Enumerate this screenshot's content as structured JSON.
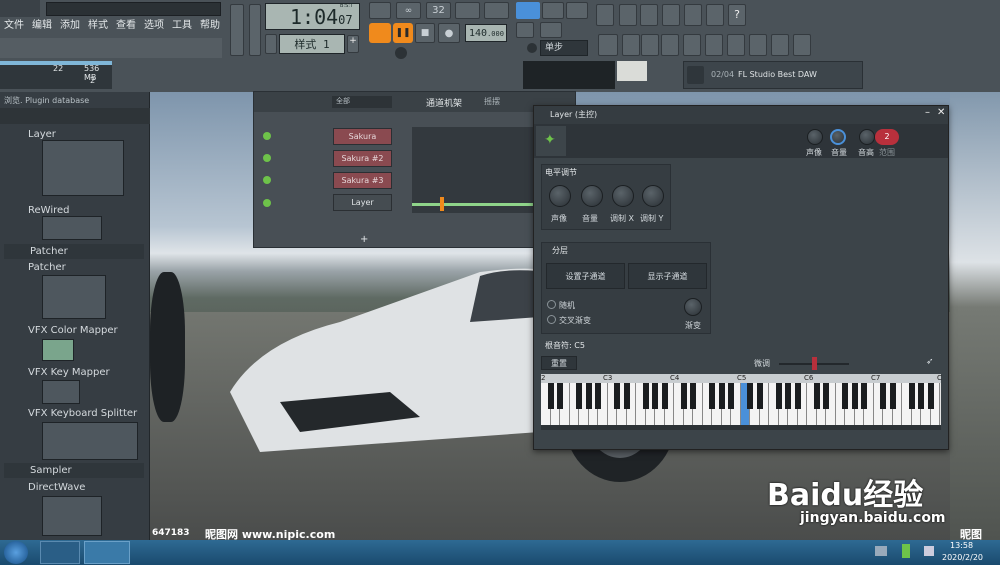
{
  "menu": [
    "文件",
    "编辑",
    "添加",
    "样式",
    "查看",
    "选项",
    "工具",
    "帮助"
  ],
  "toolbar": {
    "time": "1:04",
    "time_small": "07",
    "time_unit": "B:S:T",
    "pattern": "样式 1",
    "tempo": "140",
    "tempo_dec": ".000",
    "snap": "单步",
    "mem_left": "22",
    "mem": "536 MB",
    "cpu": "2",
    "hint_num": "02/04",
    "hint": "FL Studio Best DAW",
    "metronome": "32"
  },
  "browser": {
    "header": "浏览. Plugin database",
    "items": [
      {
        "type": "item",
        "label": "Layer"
      },
      {
        "type": "item",
        "label": "ReWired"
      },
      {
        "type": "section",
        "label": "Patcher"
      },
      {
        "type": "item",
        "label": "Patcher"
      },
      {
        "type": "item",
        "label": "VFX Color Mapper"
      },
      {
        "type": "item",
        "label": "VFX Key Mapper"
      },
      {
        "type": "item",
        "label": "VFX Keyboard Splitter"
      },
      {
        "type": "section",
        "label": "Sampler"
      },
      {
        "type": "item",
        "label": "DirectWave"
      }
    ]
  },
  "channel_rack": {
    "filter": "全部",
    "title": "通道机架",
    "swing": "摇摆",
    "channels": [
      "Sakura",
      "Sakura #2",
      "Sakura #3",
      "Layer"
    ],
    "add": "+"
  },
  "layer": {
    "title": "Layer (主控)",
    "head_knobs": [
      "声像",
      "音量",
      "音高"
    ],
    "range": "2",
    "range_label": "范围",
    "level_title": "电平调节",
    "level_knobs": [
      "声像",
      "音量",
      "调制 X",
      "调制 Y"
    ],
    "layer_title": "分层",
    "set_children": "设置子通道",
    "show_children": "显示子通道",
    "random": "随机",
    "crossfade": "交叉渐变",
    "fade": "渐变",
    "root_note": "根音符: C5",
    "reset": "重置",
    "finetune": "微调",
    "octaves": [
      "2",
      "C3",
      "C4",
      "C5",
      "C6",
      "C7",
      "C"
    ]
  },
  "watermark": {
    "left": "647183",
    "site_left": "昵图网 www.nipic.com",
    "baidu": "Baidu经验",
    "url": "jingyan.baidu.com",
    "right": "昵图"
  },
  "taskbar": {
    "time": "13:58",
    "date": "2020/2/20"
  },
  "colors": {
    "accent": "#f08a1c",
    "active_key": "#4a90d9",
    "channel": "#8a4a50",
    "led": "#6ec34a"
  }
}
